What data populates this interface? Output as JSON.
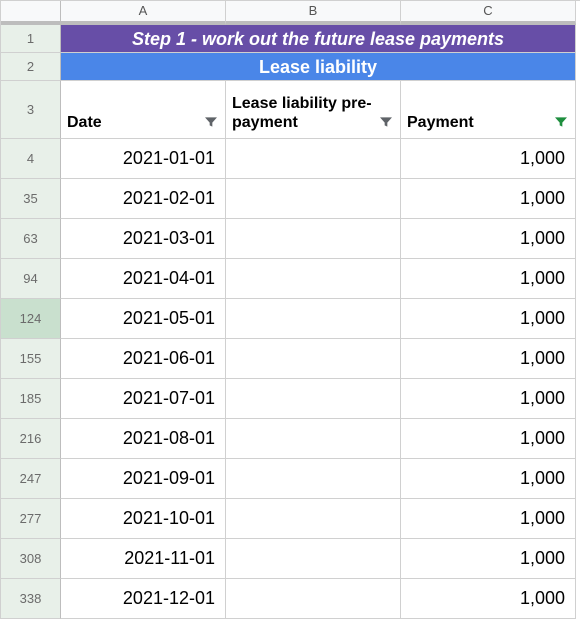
{
  "chart_data": {
    "type": "table",
    "title": "Step 1 - work out the future lease payments",
    "columns": [
      "Date",
      "Lease liability pre-payment",
      "Payment"
    ],
    "rows": [
      [
        "2021-01-01",
        null,
        1000
      ],
      [
        "2021-02-01",
        null,
        1000
      ],
      [
        "2021-03-01",
        null,
        1000
      ],
      [
        "2021-04-01",
        null,
        1000
      ],
      [
        "2021-05-01",
        null,
        1000
      ],
      [
        "2021-06-01",
        null,
        1000
      ],
      [
        "2021-07-01",
        null,
        1000
      ],
      [
        "2021-08-01",
        null,
        1000
      ],
      [
        "2021-09-01",
        null,
        1000
      ],
      [
        "2021-10-01",
        null,
        1000
      ],
      [
        "2021-11-01",
        null,
        1000
      ],
      [
        "2021-12-01",
        null,
        1000
      ]
    ]
  },
  "columns": {
    "a": "A",
    "b": "B",
    "c": "C"
  },
  "row1": {
    "num": "1",
    "title": "Step 1 - work out the future lease payments"
  },
  "row2": {
    "num": "2",
    "subtitle": "Lease liability"
  },
  "row3": {
    "num": "3",
    "h_a": "Date",
    "h_b": "Lease liability pre-payment",
    "h_c": "Payment"
  },
  "colors": {
    "filter_normal": "#5f6368",
    "filter_active": "#1e8e3e"
  },
  "data_rows": [
    {
      "num": "4",
      "date": "2021-01-01",
      "pre": "",
      "pay": "1,000",
      "sel": false
    },
    {
      "num": "35",
      "date": "2021-02-01",
      "pre": "",
      "pay": "1,000",
      "sel": false
    },
    {
      "num": "63",
      "date": "2021-03-01",
      "pre": "",
      "pay": "1,000",
      "sel": false
    },
    {
      "num": "94",
      "date": "2021-04-01",
      "pre": "",
      "pay": "1,000",
      "sel": false
    },
    {
      "num": "124",
      "date": "2021-05-01",
      "pre": "",
      "pay": "1,000",
      "sel": true
    },
    {
      "num": "155",
      "date": "2021-06-01",
      "pre": "",
      "pay": "1,000",
      "sel": false
    },
    {
      "num": "185",
      "date": "2021-07-01",
      "pre": "",
      "pay": "1,000",
      "sel": false
    },
    {
      "num": "216",
      "date": "2021-08-01",
      "pre": "",
      "pay": "1,000",
      "sel": false
    },
    {
      "num": "247",
      "date": "2021-09-01",
      "pre": "",
      "pay": "1,000",
      "sel": false
    },
    {
      "num": "277",
      "date": "2021-10-01",
      "pre": "",
      "pay": "1,000",
      "sel": false
    },
    {
      "num": "308",
      "date": "2021-11-01",
      "pre": "",
      "pay": "1,000",
      "sel": false
    },
    {
      "num": "338",
      "date": "2021-12-01",
      "pre": "",
      "pay": "1,000",
      "sel": false
    }
  ]
}
